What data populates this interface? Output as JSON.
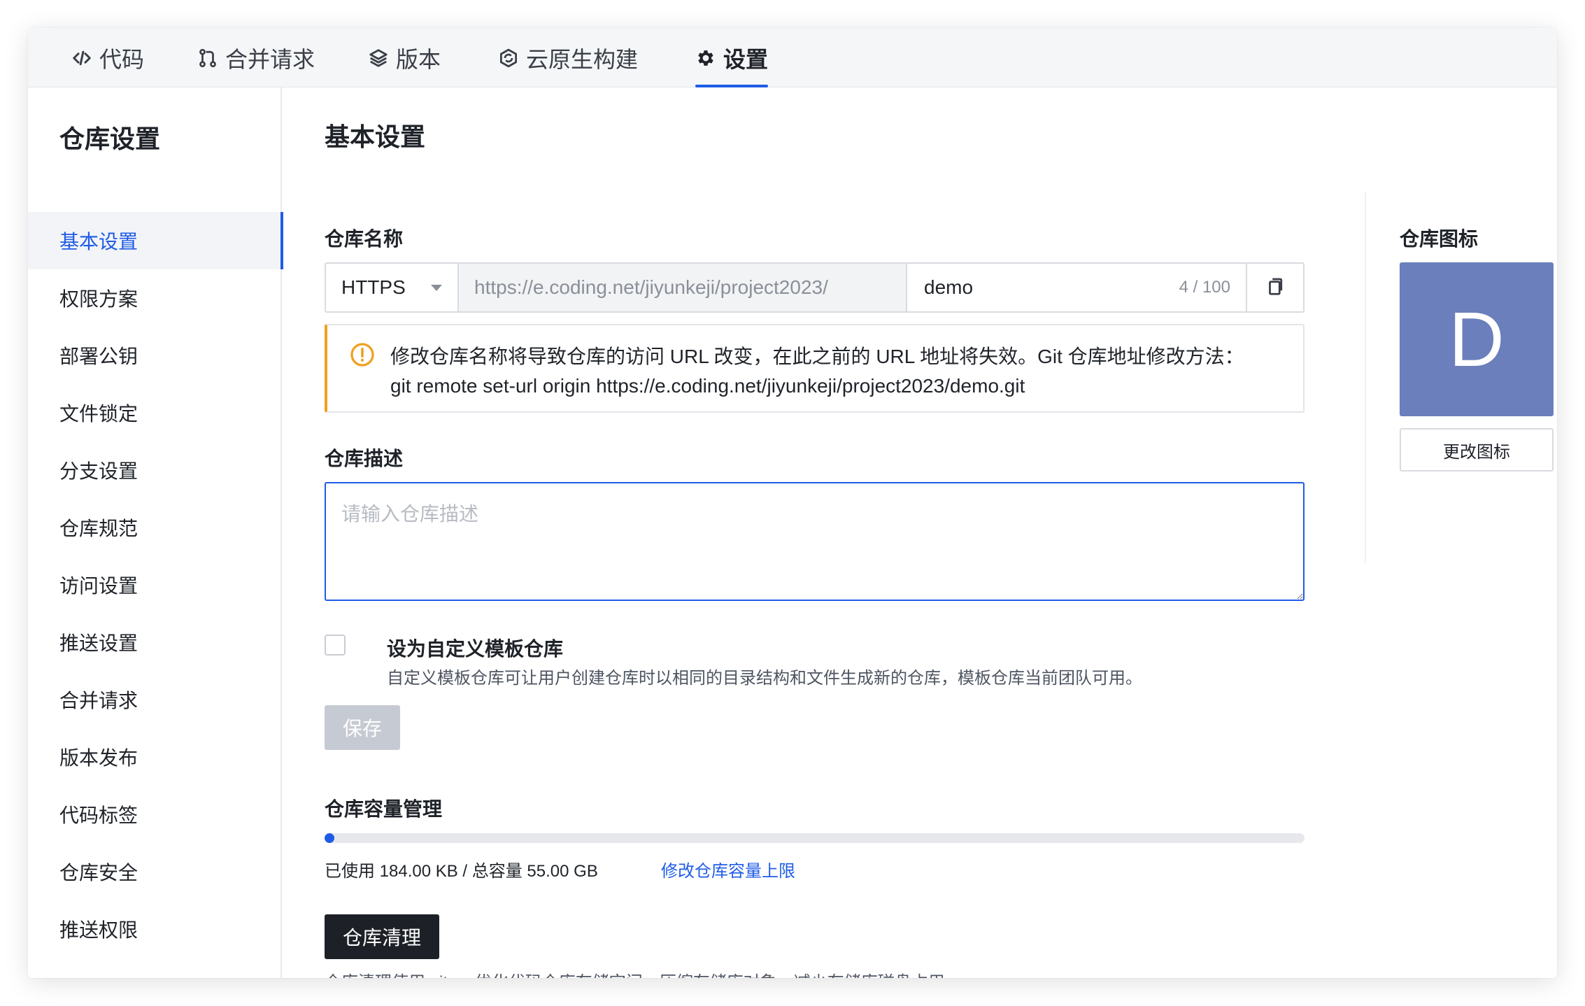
{
  "nav": {
    "tabs": [
      {
        "label": "代码",
        "icon": "code-icon"
      },
      {
        "label": "合并请求",
        "icon": "merge-request-icon"
      },
      {
        "label": "版本",
        "icon": "layers-icon"
      },
      {
        "label": "云原生构建",
        "icon": "cloud-build-icon"
      },
      {
        "label": "设置",
        "icon": "gear-icon",
        "active": true
      }
    ]
  },
  "sidebar": {
    "title": "仓库设置",
    "items": [
      {
        "label": "基本设置",
        "active": true
      },
      {
        "label": "权限方案"
      },
      {
        "label": "部署公钥"
      },
      {
        "label": "文件锁定"
      },
      {
        "label": "分支设置"
      },
      {
        "label": "仓库规范"
      },
      {
        "label": "访问设置"
      },
      {
        "label": "推送设置"
      },
      {
        "label": "合并请求"
      },
      {
        "label": "版本发布"
      },
      {
        "label": "代码标签"
      },
      {
        "label": "仓库安全"
      },
      {
        "label": "推送权限"
      }
    ]
  },
  "main": {
    "title": "基本设置",
    "repo_name": {
      "label": "仓库名称",
      "protocol": "HTTPS",
      "url_prefix": "https://e.coding.net/jiyunkeji/project2023/",
      "value": "demo",
      "counter": "4 / 100"
    },
    "alert": {
      "line1": "修改仓库名称将导致仓库的访问 URL 改变，在此之前的 URL 地址将失效。Git 仓库地址修改方法：",
      "line2": "git remote set-url origin https://e.coding.net/jiyunkeji/project2023/demo.git",
      "color": "#f0a020"
    },
    "description": {
      "label": "仓库描述",
      "placeholder": "请输入仓库描述",
      "value": ""
    },
    "template": {
      "label": "设为自定义模板仓库",
      "hint": "自定义模板仓库可让用户创建仓库时以相同的目录结构和文件生成新的仓库，模板仓库当前团队可用。",
      "checked": false
    },
    "save_label": "保存",
    "capacity": {
      "label": "仓库容量管理",
      "used_text": "已使用 184.00 KB / 总容量 55.00 GB",
      "used_fraction": 0.0033,
      "modify_link": "修改仓库容量上限"
    },
    "cleanup": {
      "label": "仓库清理",
      "hint": "仓库清理使用 git gc 优化代码仓库存储空间，压缩存储库对象，减少存储库磁盘占用。"
    },
    "repo_icon": {
      "label": "仓库图标",
      "letter": "D",
      "color": "#6a7fbb",
      "change_label": "更改图标"
    },
    "accent": "#1f5ce6"
  }
}
